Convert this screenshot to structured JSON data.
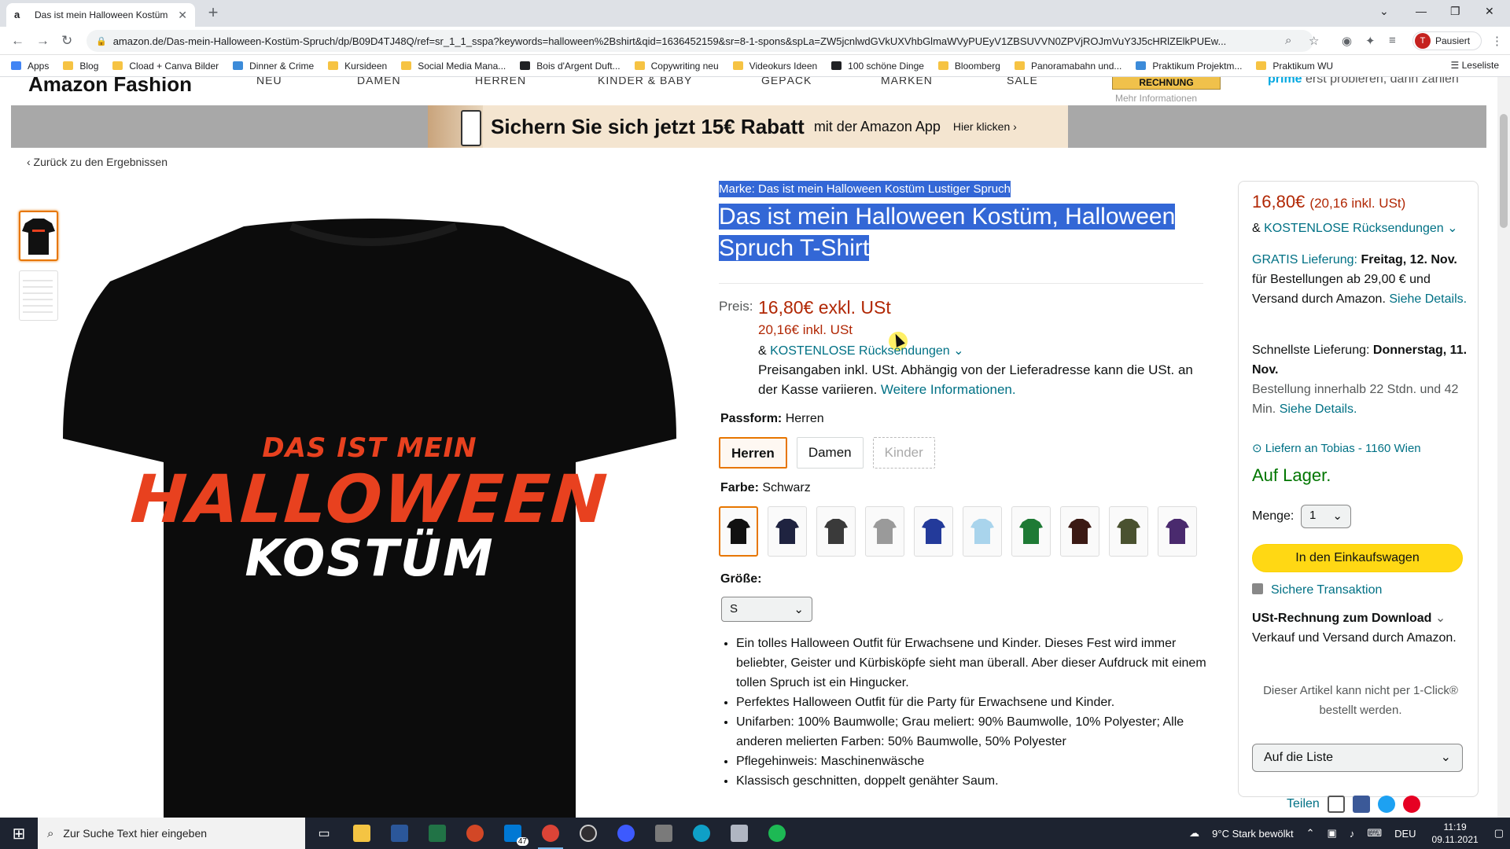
{
  "browser": {
    "tab_title": "Das ist mein Halloween Kostüm",
    "url": "amazon.de/Das-mein-Halloween-Kostüm-Spruch/dp/B09D4TJ48Q/ref=sr_1_1_sspa?keywords=halloween%2Bshirt&qid=1636452159&sr=8-1-spons&spLa=ZW5jcnlwdGVkUXVhbGlmaWVyPUEyV1ZBSUVVN0ZPVjROJmVuY3J5cHRlZElkPUEw...",
    "profile_letter": "T",
    "profile_status": "Pausiert",
    "bookmarks": [
      {
        "label": "Apps",
        "icon": "apps-grid-icon"
      },
      {
        "label": "Blog",
        "icon": "folder-icon"
      },
      {
        "label": "Cload + Canva Bilder",
        "icon": "folder-icon"
      },
      {
        "label": "Dinner & Crime",
        "icon": "jd-icon"
      },
      {
        "label": "Kursideen",
        "icon": "folder-icon"
      },
      {
        "label": "Social Media Mana...",
        "icon": "folder-icon"
      },
      {
        "label": "Bois d'Argent Duft...",
        "icon": "dior-icon"
      },
      {
        "label": "Copywriting neu",
        "icon": "folder-icon"
      },
      {
        "label": "Videokurs Ideen",
        "icon": "folder-icon"
      },
      {
        "label": "100 schöne Dinge",
        "icon": "b-icon"
      },
      {
        "label": "Bloomberg",
        "icon": "folder-icon"
      },
      {
        "label": "Panoramabahn und...",
        "icon": "folder-icon"
      },
      {
        "label": "Praktikum Projektm...",
        "icon": "j-icon"
      },
      {
        "label": "Praktikum WU",
        "icon": "folder-icon"
      }
    ],
    "reading_list": "Leseliste"
  },
  "fashion_nav": {
    "logo": "Amazon Fashion",
    "items": [
      "NEU",
      "DAMEN",
      "HERREN",
      "KINDER & BABY",
      "GEPÄCK",
      "MARKEN",
      "SALE"
    ],
    "rechnung": "RECHNUNG",
    "mehr_info": "Mehr Informationen",
    "prime_promo_a": "prime",
    "prime_promo_b": "erst probieren, dann zahlen"
  },
  "banner": {
    "headline": "Sichern Sie sich jetzt 15€ Rabatt",
    "sub": "mit der Amazon App",
    "cta": "Hier klicken ›"
  },
  "back_link": "‹ Zurück zu den Ergebnissen",
  "image": {
    "line1": "DAS IST MEIN",
    "line2": "HALLOWEEN",
    "line3": "KOSTÜM"
  },
  "product": {
    "brand": "Marke: Das ist mein Halloween Kostüm Lustiger Spruch",
    "title_line1": "Das ist mein Halloween Kostüm, Halloween",
    "title_line2": "Spruch T-Shirt",
    "price_label": "Preis:",
    "price_exkl": "16,80€ exkl. USt",
    "price_inkl": "20,16€ inkl. USt",
    "returns_prefix": "& ",
    "returns_link": "KOSTENLOSE Rücksendungen",
    "price_info": "Preisangaben inkl. USt. Abhängig von der Lieferadresse kann die USt. an der Kasse variieren.",
    "price_info_link": "Weitere Informationen.",
    "fit_label": "Passform:",
    "fit_value": "Herren",
    "fits": [
      "Herren",
      "Damen",
      "Kinder"
    ],
    "color_label": "Farbe:",
    "color_value": "Schwarz",
    "colors": [
      "#111111",
      "#1f2340",
      "#3a3a3a",
      "#9a9a9a",
      "#233a9a",
      "#a9d4ec",
      "#1e7a35",
      "#3b1a14",
      "#4a5230",
      "#4a2a6e"
    ],
    "size_label": "Größe:",
    "size_value": "S",
    "bullets": [
      "Ein tolles Halloween Outfit für Erwachsene und Kinder. Dieses Fest wird immer beliebter, Geister und Kürbisköpfe sieht man überall. Aber dieser Aufdruck mit einem tollen Spruch ist ein Hingucker.",
      "Perfektes Halloween Outfit für die Party für Erwachsene und Kinder.",
      "Unifarben: 100% Baumwolle; Grau meliert: 90% Baumwolle, 10% Polyester; Alle anderen melierten Farben: 50% Baumwolle, 50% Polyester",
      "Pflegehinweis: Maschinenwäsche",
      "Klassisch geschnitten, doppelt genähter Saum."
    ]
  },
  "buybox": {
    "price": "16,80€",
    "price_inkl": "(20,16 inkl. USt)",
    "returns_link": "KOSTENLOSE Rücksendungen",
    "free_delivery_link": "GRATIS Lieferung:",
    "free_delivery_date": "Freitag, 12. Nov.",
    "free_delivery_text": "für Bestellungen ab 29,00 € und Versand durch Amazon.",
    "details_link": "Siehe Details.",
    "fast_label": "Schnellste Lieferung:",
    "fast_date": "Donnerstag, 11. Nov.",
    "fast_text": "Bestellung innerhalb 22 Stdn. und 42 Min.",
    "location": "Liefern an Tobias - 1160 Wien",
    "stock": "Auf Lager.",
    "qty_label": "Menge:",
    "qty_value": "1",
    "cart_button": "In den Einkaufswagen",
    "secure": "Sichere Transaktion",
    "ust_title": "USt-Rechnung zum Download",
    "ust_text": "Verkauf und Versand durch Amazon.",
    "oneclick": "Dieser Artikel kann nicht per 1-Click® bestellt werden.",
    "list_button": "Auf die Liste",
    "share_label": "Teilen"
  },
  "taskbar": {
    "search_placeholder": "Zur Suche Text hier eingeben",
    "mail_badge": "47",
    "weather": "9°C  Stark bewölkt",
    "lang": "DEU",
    "time": "11:19",
    "date": "09.11.2021"
  }
}
